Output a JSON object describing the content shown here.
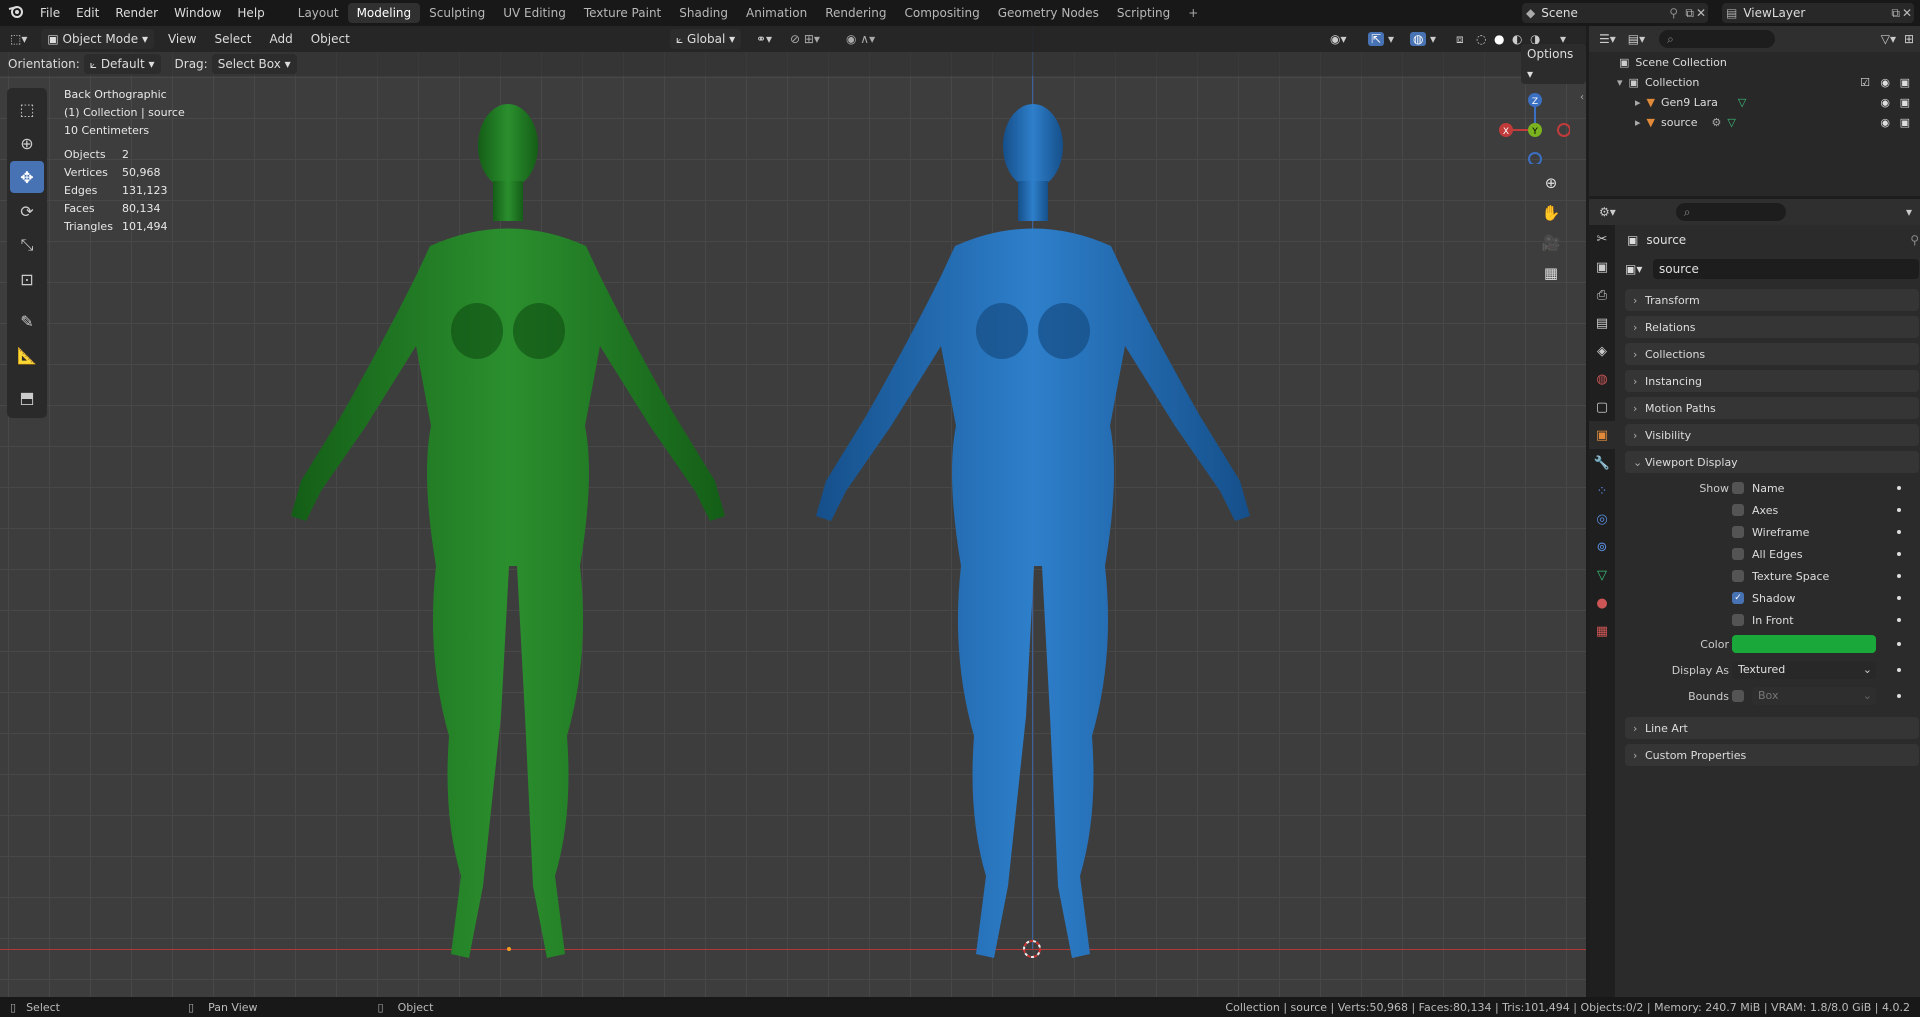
{
  "topbar": {
    "menus": [
      "File",
      "Edit",
      "Render",
      "Window",
      "Help"
    ],
    "workspace_tabs": [
      "Layout",
      "Modeling",
      "Sculpting",
      "UV Editing",
      "Texture Paint",
      "Shading",
      "Animation",
      "Rendering",
      "Compositing",
      "Geometry Nodes",
      "Scripting"
    ],
    "active_tab": "Modeling",
    "scene": "Scene",
    "view_layer": "ViewLayer"
  },
  "viewport": {
    "mode": "Object Mode",
    "menus": [
      "View",
      "Select",
      "Add",
      "Object"
    ],
    "transform_orientation": "Global",
    "orientation_label": "Orientation:",
    "orientation_value": "Default",
    "drag_label": "Drag:",
    "drag_value": "Select Box",
    "options_label": "Options",
    "view_name": "Back Orthographic",
    "collection_info": "(1) Collection | source",
    "scale": "10 Centimeters",
    "stats": [
      {
        "label": "Objects",
        "value": "2"
      },
      {
        "label": "Vertices",
        "value": "50,968"
      },
      {
        "label": "Edges",
        "value": "131,123"
      },
      {
        "label": "Faces",
        "value": "80,134"
      },
      {
        "label": "Triangles",
        "value": "101,494"
      }
    ],
    "gizmo_axes": {
      "x": "X",
      "y": "Y",
      "z": "Z"
    },
    "colors": {
      "green_model": "#1f7a22",
      "blue_model": "#1f66ad",
      "grid": "#3d3d3d",
      "x_axis": "#c23b3b",
      "z_axis": "#3b6fc2"
    }
  },
  "outliner": {
    "root": "Scene Collection",
    "collection": "Collection",
    "items": [
      "Gen9 Lara",
      "source"
    ]
  },
  "properties": {
    "object_name": "source",
    "data_name": "source",
    "sections": [
      "Transform",
      "Relations",
      "Collections",
      "Instancing",
      "Motion Paths",
      "Visibility"
    ],
    "viewport_display": {
      "title": "Viewport Display",
      "show_label": "Show",
      "checks": [
        {
          "label": "Name",
          "checked": false
        },
        {
          "label": "Axes",
          "checked": false
        },
        {
          "label": "Wireframe",
          "checked": false
        },
        {
          "label": "All Edges",
          "checked": false
        },
        {
          "label": "Texture Space",
          "checked": false
        },
        {
          "label": "Shadow",
          "checked": true
        },
        {
          "label": "In Front",
          "checked": false
        }
      ],
      "color_label": "Color",
      "color_value": "#1ba83a",
      "display_as_label": "Display As",
      "display_as_value": "Textured",
      "bounds_label": "Bounds",
      "bounds_value": "Box"
    },
    "sections_after": [
      "Line Art",
      "Custom Properties"
    ]
  },
  "statusbar": {
    "left": [
      {
        "key": "select",
        "label": "Select"
      },
      {
        "key": "pan",
        "label": "Pan View"
      },
      {
        "key": "object",
        "label": "Object"
      }
    ],
    "right": "Collection | source | Verts:50,968 | Faces:80,134 | Tris:101,494 | Objects:0/2 | Memory: 240.7 MiB | VRAM: 1.8/8.0 GiB | 4.0.2"
  }
}
